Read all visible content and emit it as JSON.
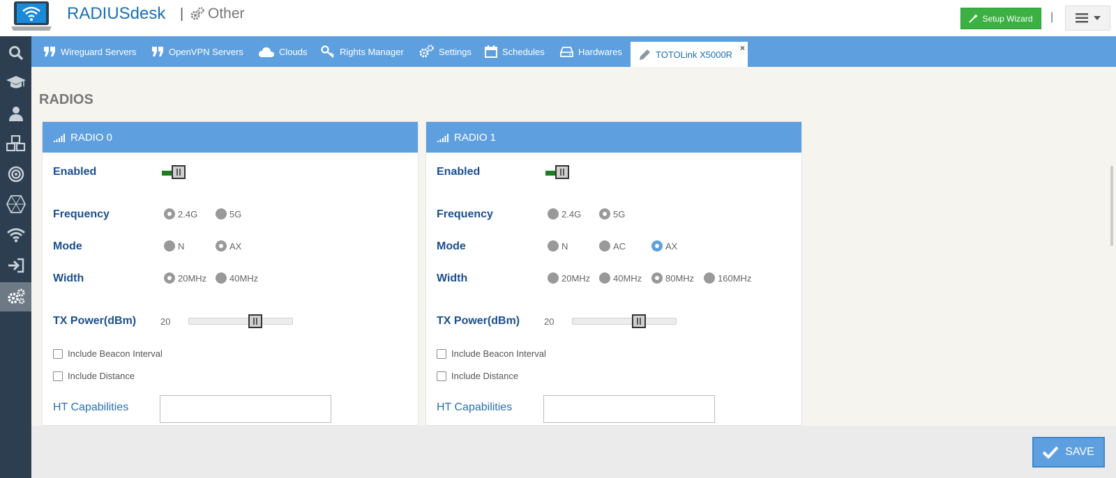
{
  "header": {
    "app_title": "RADIUSdesk",
    "separator": "|",
    "section": "Other",
    "setup_wizard": "Setup Wizard",
    "pipe": "|"
  },
  "tabs": [
    {
      "label": "Wireguard Servers",
      "icon": "quote-icon"
    },
    {
      "label": "OpenVPN Servers",
      "icon": "quote-icon"
    },
    {
      "label": "Clouds",
      "icon": "cloud-icon"
    },
    {
      "label": "Rights Manager",
      "icon": "key-icon"
    },
    {
      "label": "Settings",
      "icon": "gears-icon"
    },
    {
      "label": "Schedules",
      "icon": "calendar-icon"
    },
    {
      "label": "Hardwares",
      "icon": "hdd-icon"
    },
    {
      "label": "TOTOLink X5000R",
      "icon": "pencil-icon",
      "close": "×"
    }
  ],
  "sidebar": [
    "search-icon",
    "graduation-cap-icon",
    "user-icon",
    "cubes-icon",
    "bullseye-icon",
    "hexagon-icon",
    "wifi-icon",
    "sign-in-icon",
    "gears-icon"
  ],
  "content": {
    "section_title": "RADIOS",
    "radio0": {
      "title": "RADIO 0",
      "enabled_label": "Enabled",
      "enabled": true,
      "frequency_label": "Frequency",
      "frequency_options": [
        "2.4G",
        "5G"
      ],
      "frequency_selected": "2.4G",
      "mode_label": "Mode",
      "mode_options": [
        "N",
        "AX"
      ],
      "mode_selected": "AX",
      "width_label": "Width",
      "width_options": [
        "20MHz",
        "40MHz"
      ],
      "width_selected": "20MHz",
      "tx_label": "TX Power(dBm)",
      "tx_value": "20",
      "beacon_label": "Include Beacon Interval",
      "distance_label": "Include Distance",
      "ht_label": "HT Capabilities"
    },
    "radio1": {
      "title": "RADIO 1",
      "enabled_label": "Enabled",
      "enabled": true,
      "frequency_label": "Frequency",
      "frequency_options": [
        "2.4G",
        "5G"
      ],
      "frequency_selected": "5G",
      "mode_label": "Mode",
      "mode_options": [
        "N",
        "AC",
        "AX"
      ],
      "mode_selected": "AX",
      "width_label": "Width",
      "width_options": [
        "20MHz",
        "40MHz",
        "80MHz",
        "160MHz"
      ],
      "width_selected": "80MHz",
      "tx_label": "TX Power(dBm)",
      "tx_value": "20",
      "beacon_label": "Include Beacon Interval",
      "distance_label": "Include Distance",
      "ht_label": "HT Capabilities"
    }
  },
  "footer": {
    "save_label": "SAVE"
  },
  "colors": {
    "accent": "#5ea0df",
    "sidebar": "#2c3e50",
    "setup": "#3cb043",
    "label": "#1b4f8f"
  }
}
